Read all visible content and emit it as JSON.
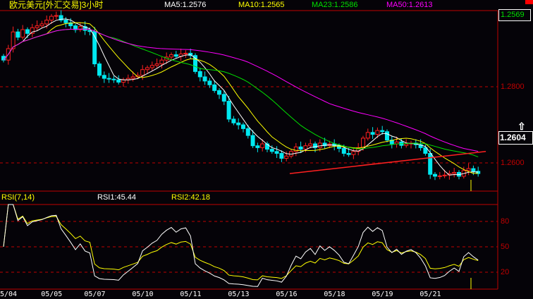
{
  "header": {
    "title": "欧元美元[外汇交易]3小时",
    "ma5": "MA5:1.2576",
    "ma10": "MA10:1.2565",
    "ma23": "MA23:1.2586",
    "ma50": "MA50:1.2613"
  },
  "rsi_header": {
    "label": "RSI(7,14)",
    "rsi1": "RSI1:45.44",
    "rsi2": "RSI2:42.18"
  },
  "price_axis": {
    "top_price": "1.2569",
    "current_price": "1.2604",
    "ticks": [
      "1.2800",
      "1.2600"
    ]
  },
  "rsi_axis": {
    "ticks": [
      "80",
      "50",
      "20"
    ]
  },
  "colors": {
    "up": "#ff2020",
    "down": "#00e8f0",
    "ma5": "#ffffff",
    "ma10": "#ffff00",
    "ma23": "#00e000",
    "ma50": "#ff00ff",
    "grid": "#c00000"
  },
  "chart_data": {
    "type": "candlestick",
    "title": "欧元美元[外汇交易]3小时",
    "ylim": [
      1.2543,
      1.299
    ],
    "x_tick_labels": [
      "5/04",
      "05/05",
      "05/07",
      "05/10",
      "05/11",
      "05/13",
      "05/16",
      "05/18",
      "05/19",
      "05/21"
    ],
    "x_tick_index": [
      0,
      9,
      18,
      28,
      38,
      48,
      58,
      68,
      78,
      88
    ],
    "closes": [
      1.287,
      1.29,
      1.2944,
      1.293,
      1.295,
      1.294,
      1.2955,
      1.296,
      1.2965,
      1.2975,
      1.2985,
      1.2987,
      1.2975,
      1.2968,
      1.296,
      1.295,
      1.2958,
      1.2948,
      1.2945,
      1.286,
      1.283,
      1.2822,
      1.282,
      1.2818,
      1.2812,
      1.2818,
      1.2822,
      1.2826,
      1.283,
      1.2845,
      1.285,
      1.2856,
      1.286,
      1.287,
      1.2878,
      1.2884,
      1.288,
      1.2886,
      1.2888,
      1.2882,
      1.284,
      1.2826,
      1.2815,
      1.2805,
      1.279,
      1.278,
      1.2762,
      1.2715,
      1.2705,
      1.27,
      1.269,
      1.2672,
      1.2645,
      1.264,
      1.265,
      1.2636,
      1.263,
      1.2625,
      1.2612,
      1.2618,
      1.263,
      1.2642,
      1.2636,
      1.2645,
      1.265,
      1.264,
      1.2652,
      1.2645,
      1.265,
      1.2645,
      1.2638,
      1.2625,
      1.2622,
      1.263,
      1.264,
      1.2665,
      1.268,
      1.2675,
      1.2685,
      1.2682,
      1.266,
      1.265,
      1.2655,
      1.2646,
      1.265,
      1.2652,
      1.2648,
      1.264,
      1.2625,
      1.257,
      1.2565,
      1.2566,
      1.2568,
      1.2572,
      1.2575,
      1.2565,
      1.258,
      1.2585,
      1.2578,
      1.2572
    ],
    "moving_averages": [
      5,
      10,
      23,
      50
    ],
    "trendline": {
      "from": [
        59.7,
        1.2572
      ],
      "to": [
        100.6,
        1.263
      ]
    },
    "rsi": {
      "periods": [
        7,
        14
      ],
      "levels": [
        80,
        50,
        20
      ],
      "ylim": [
        0,
        100
      ]
    }
  }
}
